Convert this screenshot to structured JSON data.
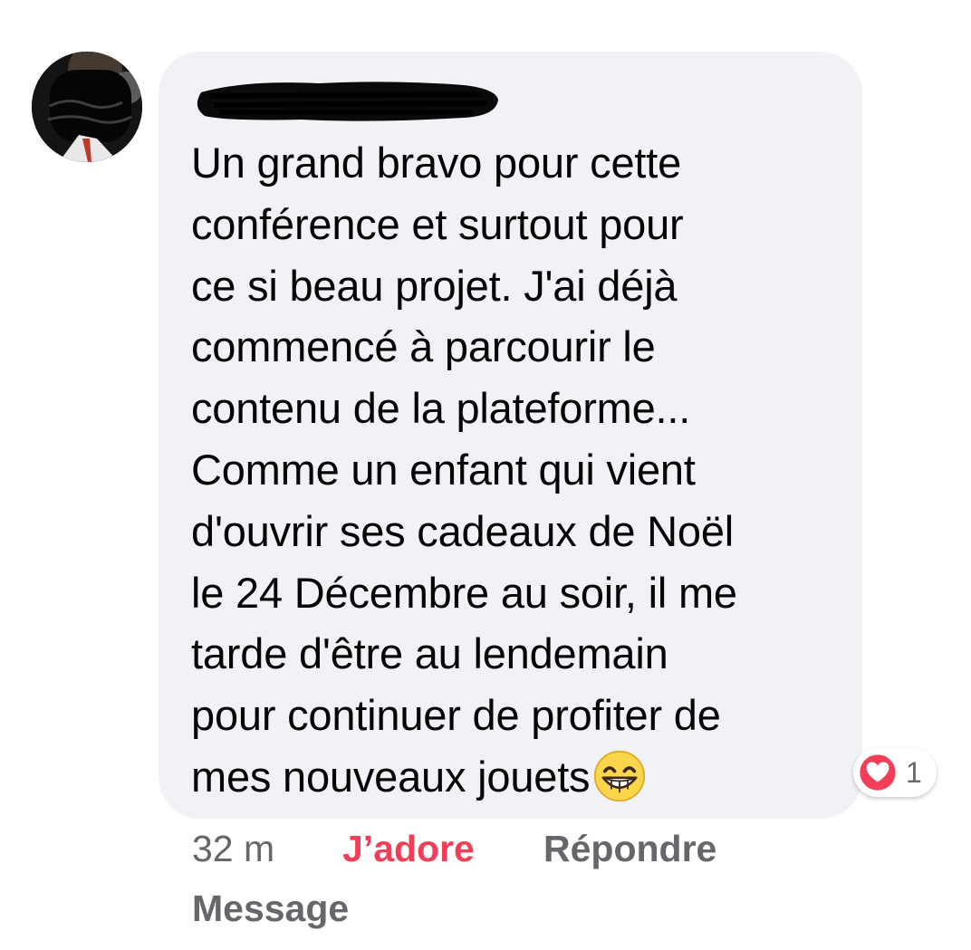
{
  "comment": {
    "author": "",
    "text": "Un grand bravo pour cette\nconférence et surtout pour\nce si beau projet. J'ai déjà\ncommencé à parcourir le\ncontenu de la plateforme...\nComme un enfant qui vient\nd'ouvrir ses cadeaux de Noël\nle 24 Décembre au soir, il me\ntarde d'être au lendemain\npour continuer de profiter de\nmes nouveaux jouets",
    "trailing_emoji": "grinning-face-with-smiling-eyes-icon",
    "reaction": {
      "icon": "heart-icon",
      "count": "1",
      "color": "#f33e58"
    }
  },
  "actions": {
    "time": "32 m",
    "love": "J’adore",
    "reply": "Répondre",
    "message": "Message"
  },
  "colors": {
    "bubble": "#f0f2f5",
    "text": "#050505",
    "muted": "#65676b",
    "love": "#f33e58"
  }
}
